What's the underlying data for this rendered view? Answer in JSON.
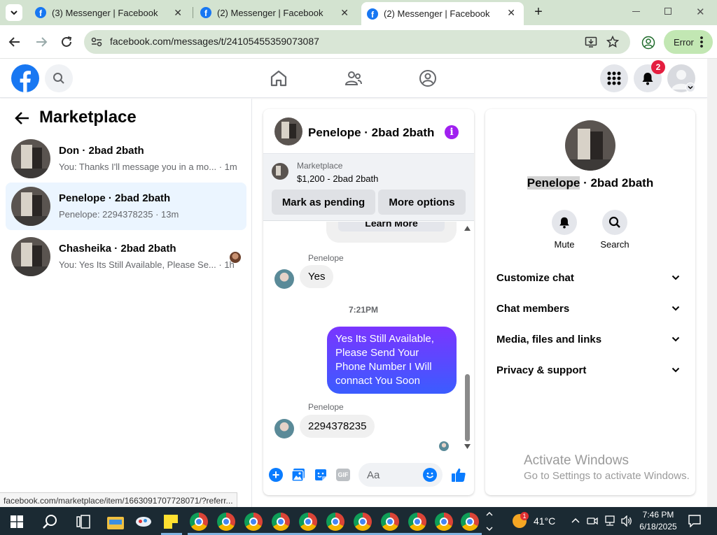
{
  "browser": {
    "tabs": [
      {
        "title": "(3) Messenger | Facebook",
        "active": false
      },
      {
        "title": "(2) Messenger | Facebook",
        "active": false
      },
      {
        "title": "(2) Messenger | Facebook",
        "active": true
      }
    ],
    "url": "facebook.com/messages/t/24105455359073087",
    "profile_button_label": "Error"
  },
  "header": {
    "notification_count": "2"
  },
  "sidebar": {
    "title": "Marketplace",
    "conversations": [
      {
        "name": "Don · 2bad 2bath",
        "preview": "You: Thanks I'll message you in a mo...",
        "time": "· 1m",
        "selected": false
      },
      {
        "name": "Penelope · 2bad 2bath",
        "preview": "Penelope: 2294378235",
        "time": "· 13m",
        "selected": true
      },
      {
        "name": "Chasheika · 2bad 2bath",
        "preview": "You: Yes Its Still Available, Please Se...",
        "time": "· 1h",
        "selected": false
      }
    ]
  },
  "chat": {
    "title": "Penelope · 2bad 2bath",
    "listing": {
      "label": "Marketplace",
      "price_title": "$1,200 - 2bad 2bath",
      "mark_pending_label": "Mark as pending",
      "more_options_label": "More options"
    },
    "partial_button_label": "Learn More",
    "messages": [
      {
        "sender": "Penelope",
        "text": "Yes",
        "direction": "in"
      },
      {
        "timestamp": "7:21PM"
      },
      {
        "text": "Yes Its Still Available, Please Send Your Phone Number I Will connact You Soon",
        "direction": "out"
      },
      {
        "sender": "Penelope",
        "text": "2294378235",
        "direction": "in"
      }
    ],
    "composer_placeholder": "Aa"
  },
  "details": {
    "name_highlight": "Penelope",
    "name_rest": " · 2bad 2bath",
    "actions": [
      {
        "label": "Mute",
        "icon": "bell-icon"
      },
      {
        "label": "Search",
        "icon": "search-icon"
      }
    ],
    "sections": [
      "Customize chat",
      "Chat members",
      "Media, files and links",
      "Privacy & support"
    ]
  },
  "watermark": {
    "title": "Activate Windows",
    "subtitle": "Go to Settings to activate Windows."
  },
  "status_bar_url": "facebook.com/marketplace/item/1663091707728071/?referr...",
  "taskbar": {
    "weather_badge": "1",
    "temperature": "41°C",
    "time": "7:46 PM",
    "date": "6/18/2025"
  },
  "colors": {
    "facebook_blue": "#1877f2",
    "selected_row": "#ebf5ff",
    "outgoing_bubble_top": "#7a35ff",
    "outgoing_bubble_bottom": "#3b5cff",
    "notification_badge": "#e41e3f",
    "info_icon": "#a020f0"
  }
}
